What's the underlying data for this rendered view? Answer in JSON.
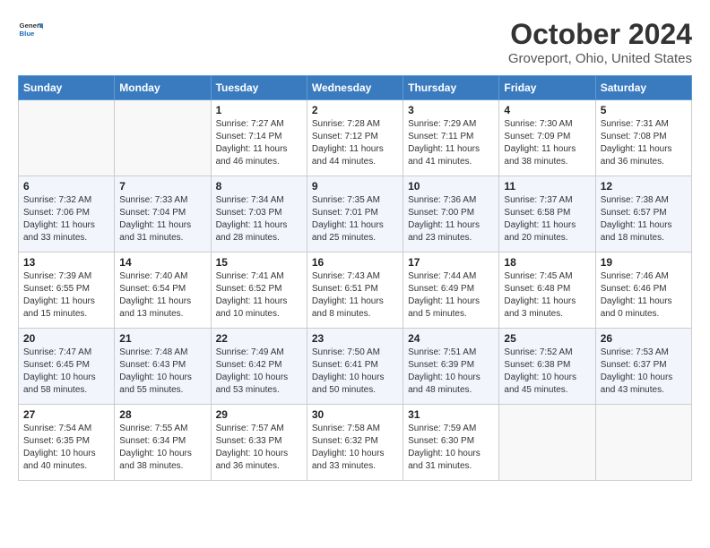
{
  "header": {
    "logo_general": "General",
    "logo_blue": "Blue",
    "title": "October 2024",
    "subtitle": "Groveport, Ohio, United States"
  },
  "columns": [
    "Sunday",
    "Monday",
    "Tuesday",
    "Wednesday",
    "Thursday",
    "Friday",
    "Saturday"
  ],
  "weeks": [
    [
      {
        "day": "",
        "empty": true
      },
      {
        "day": "",
        "empty": true
      },
      {
        "day": "1",
        "sunrise": "Sunrise: 7:27 AM",
        "sunset": "Sunset: 7:14 PM",
        "daylight": "Daylight: 11 hours and 46 minutes."
      },
      {
        "day": "2",
        "sunrise": "Sunrise: 7:28 AM",
        "sunset": "Sunset: 7:12 PM",
        "daylight": "Daylight: 11 hours and 44 minutes."
      },
      {
        "day": "3",
        "sunrise": "Sunrise: 7:29 AM",
        "sunset": "Sunset: 7:11 PM",
        "daylight": "Daylight: 11 hours and 41 minutes."
      },
      {
        "day": "4",
        "sunrise": "Sunrise: 7:30 AM",
        "sunset": "Sunset: 7:09 PM",
        "daylight": "Daylight: 11 hours and 38 minutes."
      },
      {
        "day": "5",
        "sunrise": "Sunrise: 7:31 AM",
        "sunset": "Sunset: 7:08 PM",
        "daylight": "Daylight: 11 hours and 36 minutes."
      }
    ],
    [
      {
        "day": "6",
        "sunrise": "Sunrise: 7:32 AM",
        "sunset": "Sunset: 7:06 PM",
        "daylight": "Daylight: 11 hours and 33 minutes."
      },
      {
        "day": "7",
        "sunrise": "Sunrise: 7:33 AM",
        "sunset": "Sunset: 7:04 PM",
        "daylight": "Daylight: 11 hours and 31 minutes."
      },
      {
        "day": "8",
        "sunrise": "Sunrise: 7:34 AM",
        "sunset": "Sunset: 7:03 PM",
        "daylight": "Daylight: 11 hours and 28 minutes."
      },
      {
        "day": "9",
        "sunrise": "Sunrise: 7:35 AM",
        "sunset": "Sunset: 7:01 PM",
        "daylight": "Daylight: 11 hours and 25 minutes."
      },
      {
        "day": "10",
        "sunrise": "Sunrise: 7:36 AM",
        "sunset": "Sunset: 7:00 PM",
        "daylight": "Daylight: 11 hours and 23 minutes."
      },
      {
        "day": "11",
        "sunrise": "Sunrise: 7:37 AM",
        "sunset": "Sunset: 6:58 PM",
        "daylight": "Daylight: 11 hours and 20 minutes."
      },
      {
        "day": "12",
        "sunrise": "Sunrise: 7:38 AM",
        "sunset": "Sunset: 6:57 PM",
        "daylight": "Daylight: 11 hours and 18 minutes."
      }
    ],
    [
      {
        "day": "13",
        "sunrise": "Sunrise: 7:39 AM",
        "sunset": "Sunset: 6:55 PM",
        "daylight": "Daylight: 11 hours and 15 minutes."
      },
      {
        "day": "14",
        "sunrise": "Sunrise: 7:40 AM",
        "sunset": "Sunset: 6:54 PM",
        "daylight": "Daylight: 11 hours and 13 minutes."
      },
      {
        "day": "15",
        "sunrise": "Sunrise: 7:41 AM",
        "sunset": "Sunset: 6:52 PM",
        "daylight": "Daylight: 11 hours and 10 minutes."
      },
      {
        "day": "16",
        "sunrise": "Sunrise: 7:43 AM",
        "sunset": "Sunset: 6:51 PM",
        "daylight": "Daylight: 11 hours and 8 minutes."
      },
      {
        "day": "17",
        "sunrise": "Sunrise: 7:44 AM",
        "sunset": "Sunset: 6:49 PM",
        "daylight": "Daylight: 11 hours and 5 minutes."
      },
      {
        "day": "18",
        "sunrise": "Sunrise: 7:45 AM",
        "sunset": "Sunset: 6:48 PM",
        "daylight": "Daylight: 11 hours and 3 minutes."
      },
      {
        "day": "19",
        "sunrise": "Sunrise: 7:46 AM",
        "sunset": "Sunset: 6:46 PM",
        "daylight": "Daylight: 11 hours and 0 minutes."
      }
    ],
    [
      {
        "day": "20",
        "sunrise": "Sunrise: 7:47 AM",
        "sunset": "Sunset: 6:45 PM",
        "daylight": "Daylight: 10 hours and 58 minutes."
      },
      {
        "day": "21",
        "sunrise": "Sunrise: 7:48 AM",
        "sunset": "Sunset: 6:43 PM",
        "daylight": "Daylight: 10 hours and 55 minutes."
      },
      {
        "day": "22",
        "sunrise": "Sunrise: 7:49 AM",
        "sunset": "Sunset: 6:42 PM",
        "daylight": "Daylight: 10 hours and 53 minutes."
      },
      {
        "day": "23",
        "sunrise": "Sunrise: 7:50 AM",
        "sunset": "Sunset: 6:41 PM",
        "daylight": "Daylight: 10 hours and 50 minutes."
      },
      {
        "day": "24",
        "sunrise": "Sunrise: 7:51 AM",
        "sunset": "Sunset: 6:39 PM",
        "daylight": "Daylight: 10 hours and 48 minutes."
      },
      {
        "day": "25",
        "sunrise": "Sunrise: 7:52 AM",
        "sunset": "Sunset: 6:38 PM",
        "daylight": "Daylight: 10 hours and 45 minutes."
      },
      {
        "day": "26",
        "sunrise": "Sunrise: 7:53 AM",
        "sunset": "Sunset: 6:37 PM",
        "daylight": "Daylight: 10 hours and 43 minutes."
      }
    ],
    [
      {
        "day": "27",
        "sunrise": "Sunrise: 7:54 AM",
        "sunset": "Sunset: 6:35 PM",
        "daylight": "Daylight: 10 hours and 40 minutes."
      },
      {
        "day": "28",
        "sunrise": "Sunrise: 7:55 AM",
        "sunset": "Sunset: 6:34 PM",
        "daylight": "Daylight: 10 hours and 38 minutes."
      },
      {
        "day": "29",
        "sunrise": "Sunrise: 7:57 AM",
        "sunset": "Sunset: 6:33 PM",
        "daylight": "Daylight: 10 hours and 36 minutes."
      },
      {
        "day": "30",
        "sunrise": "Sunrise: 7:58 AM",
        "sunset": "Sunset: 6:32 PM",
        "daylight": "Daylight: 10 hours and 33 minutes."
      },
      {
        "day": "31",
        "sunrise": "Sunrise: 7:59 AM",
        "sunset": "Sunset: 6:30 PM",
        "daylight": "Daylight: 10 hours and 31 minutes."
      },
      {
        "day": "",
        "empty": true
      },
      {
        "day": "",
        "empty": true
      }
    ]
  ]
}
